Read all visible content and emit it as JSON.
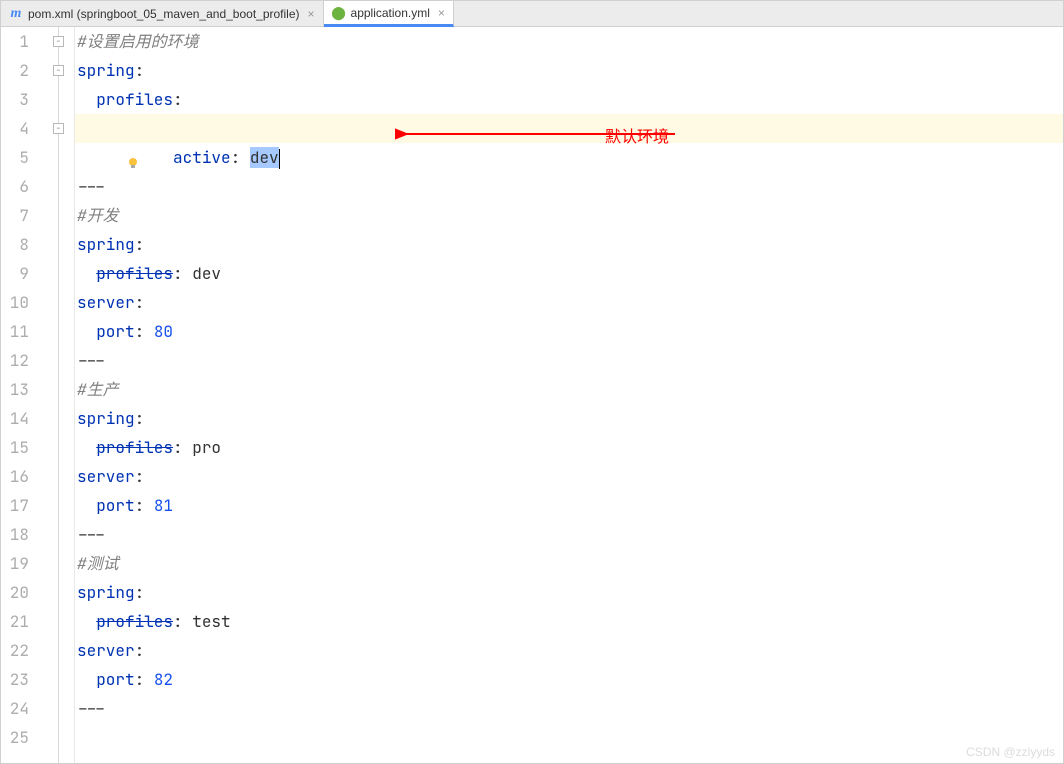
{
  "tabs": [
    {
      "label": "pom.xml (springboot_05_maven_and_boot_profile)",
      "iconType": "maven",
      "active": false
    },
    {
      "label": "application.yml",
      "iconType": "spring",
      "active": true
    }
  ],
  "lines": {
    "count": 25
  },
  "code": {
    "l1_comment": "#设置启用的环境",
    "l2_key": "spring",
    "l3_key": "profiles",
    "l4_key": "active",
    "l4_val": "dev",
    "l6_sep": "---",
    "l7_comment": "#开发",
    "l8_key": "spring",
    "l9_key": "profiles",
    "l9_val": "dev",
    "l10_key": "server",
    "l11_key": "port",
    "l11_val": "80",
    "l12_sep": "---",
    "l13_comment": "#生产",
    "l14_key": "spring",
    "l15_key": "profiles",
    "l15_val": "pro",
    "l16_key": "server",
    "l17_key": "port",
    "l17_val": "81",
    "l18_sep": "---",
    "l19_comment": "#测试",
    "l20_key": "spring",
    "l21_key": "profiles",
    "l21_val": "test",
    "l22_key": "server",
    "l23_key": "port",
    "l23_val": "82",
    "l24_sep": "---"
  },
  "annotation": {
    "label": "默认环境"
  },
  "watermark": "CSDN @zzlyyds"
}
